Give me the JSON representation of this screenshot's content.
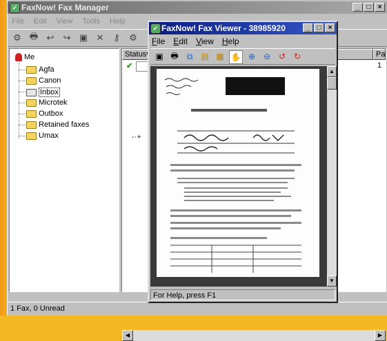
{
  "manager": {
    "title": "FaxNow! Fax Manager",
    "menu": [
      "File",
      "Edit",
      "View",
      "Tools",
      "Help"
    ],
    "toolbar_icons": [
      "connect-icon",
      "print-icon",
      "reply-icon",
      "forward-icon",
      "save-icon",
      "delete-icon",
      "key-icon",
      "settings-icon"
    ],
    "tree": {
      "root": "Me",
      "folders": [
        "Agfa",
        "Canon",
        "Inbox",
        "Microtek",
        "Outbox",
        "Retained faxes",
        "Umax"
      ],
      "selected": "Inbox"
    },
    "list": {
      "columns": [
        "Status",
        "Pa"
      ],
      "rows": [
        {
          "status": "✔",
          "pages": "1"
        }
      ]
    },
    "status_text": "1 Fax, 0 Unread"
  },
  "viewer": {
    "title": "FaxNow! Fax Viewer - 38985920",
    "menu": [
      "File",
      "Edit",
      "View",
      "Help"
    ],
    "status_text": "For Help, press F1"
  }
}
